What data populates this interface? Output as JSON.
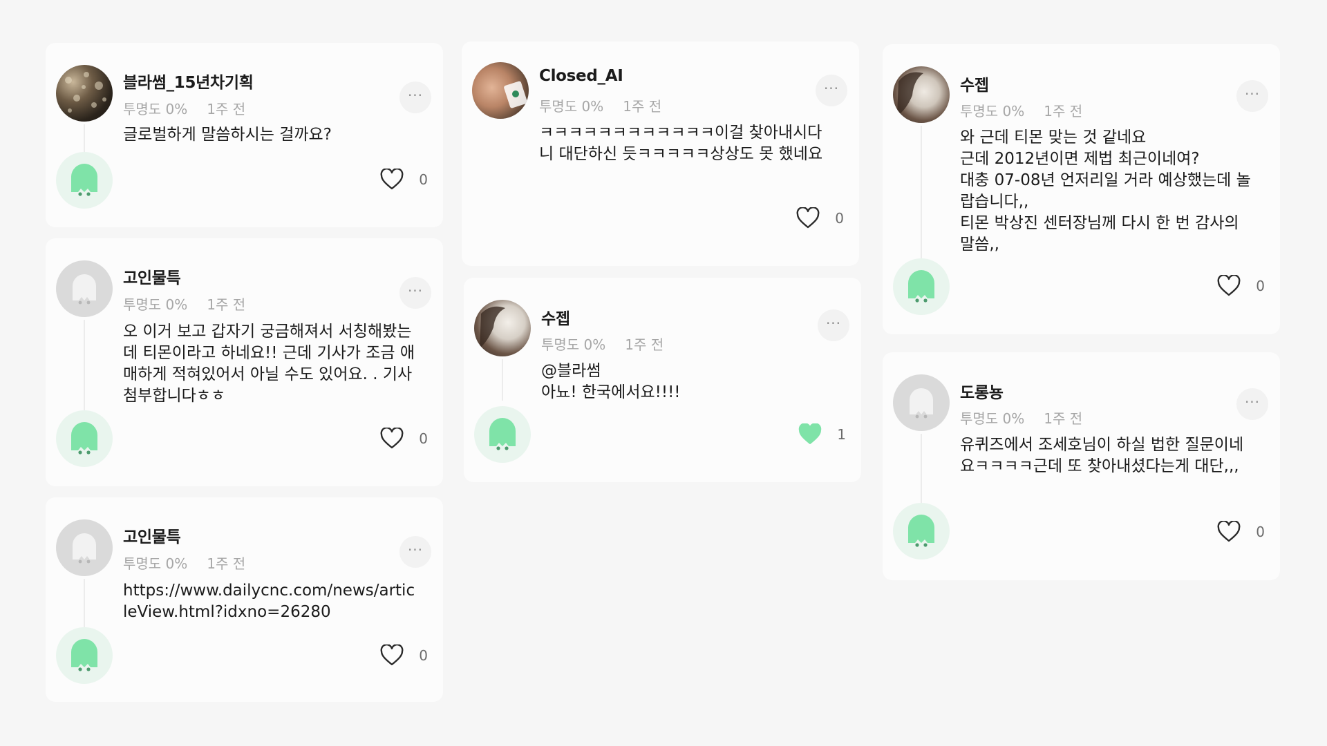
{
  "colors": {
    "background": "#f6f6f6",
    "card": "#fcfcfc",
    "ghost_green": "#7fe3a8",
    "ghost_gray": "#d6d6d6",
    "liked_heart": "#7fe3a8"
  },
  "comments": [
    {
      "username": "블라썸_15년차기획",
      "transparency": "투명도 0%",
      "time": "1주 전",
      "body": "글로벌하게 말씀하시는 걸까요?",
      "likes": "0",
      "liked": false,
      "avatar_icon": "photo-avatar"
    },
    {
      "username": "고인물특",
      "transparency": "투명도 0%",
      "time": "1주 전",
      "body": "오 이거 보고 갑자기 궁금해져서 서칭해봤는데 티몬이라고 하네요!! 근데 기사가 조금 애매하게 적혀있어서 아닐 수도 있어요. . 기사 첨부합니다ㅎㅎ",
      "likes": "0",
      "liked": false,
      "avatar_icon": "ghost-avatar"
    },
    {
      "username": "고인물특",
      "transparency": "투명도 0%",
      "time": "1주 전",
      "body": "https://www.dailycnc.com/news/articleView.html?idxno=26280",
      "likes": "0",
      "liked": false,
      "avatar_icon": "ghost-avatar"
    },
    {
      "username": "Closed_AI",
      "transparency": "투명도 0%",
      "time": "1주 전",
      "body": "ㅋㅋㅋㅋㅋㅋㅋㅋㅋㅋㅋㅋ이걸 찾아내시다니 대단하신 듯ㅋㅋㅋㅋㅋ상상도 못 했네요",
      "likes": "0",
      "liked": false,
      "avatar_icon": "photo-avatar"
    },
    {
      "username": "수젭",
      "transparency": "투명도 0%",
      "time": "1주 전",
      "body": "@블라썸\n아뇨! 한국에서요!!!!",
      "likes": "1",
      "liked": true,
      "avatar_icon": "photo-avatar"
    },
    {
      "username": "수젭",
      "transparency": "투명도 0%",
      "time": "1주 전",
      "body": "와 근데 티몬 맞는 것 같네요\n근데 2012년이면 제법 최근이네여?\n대충 07-08년 언저리일 거라 예상했는데 놀랍습니다,,\n티몬 박상진 센터장님께 다시 한 번 감사의 말씀,,",
      "likes": "0",
      "liked": false,
      "avatar_icon": "photo-avatar"
    },
    {
      "username": "도롱뇽",
      "transparency": "투명도 0%",
      "time": "1주 전",
      "body": "유퀴즈에서 조세호님이 하실 법한 질문이네요ㅋㅋㅋㅋ근데 또 찾아내셨다는게 대단,,,",
      "likes": "0",
      "liked": false,
      "avatar_icon": "ghost-avatar"
    }
  ],
  "more_label": "···"
}
